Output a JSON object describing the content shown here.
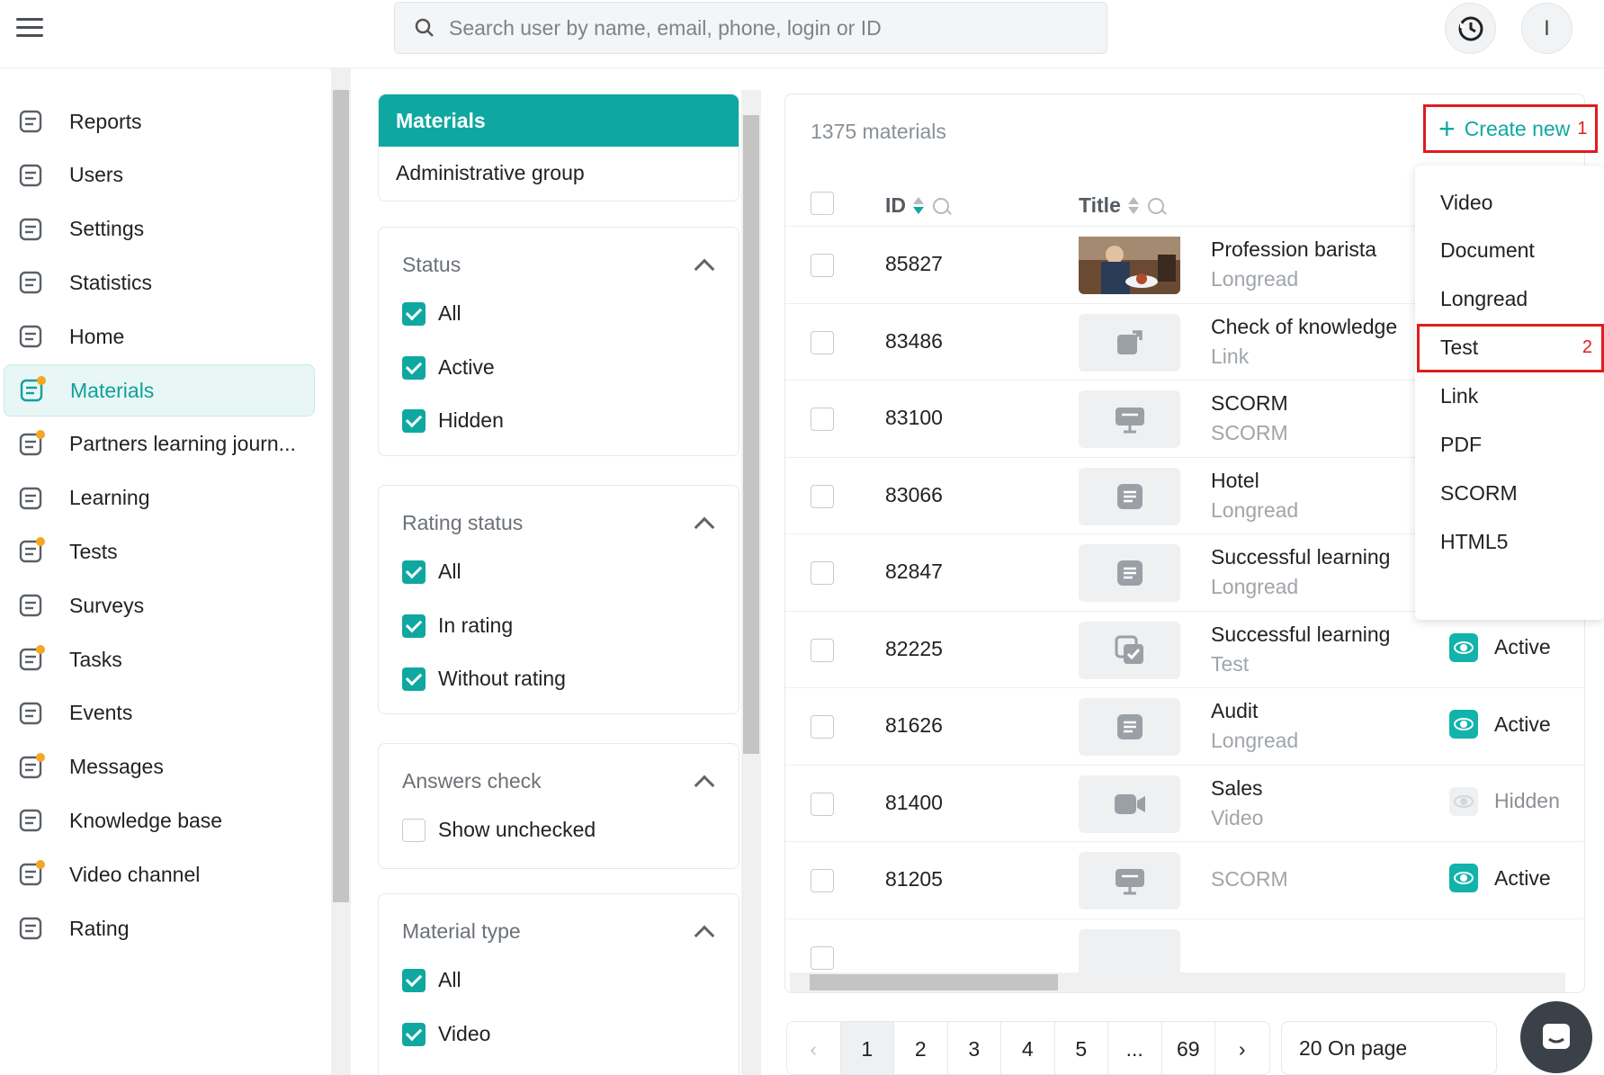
{
  "header": {
    "search_placeholder": "Search user by name, email, phone, login or ID",
    "avatar_initial": "I"
  },
  "sidebar": {
    "items": [
      {
        "label": "Reports",
        "icon": "reports-icon"
      },
      {
        "label": "Users",
        "icon": "users-icon"
      },
      {
        "label": "Settings",
        "icon": "gear-icon"
      },
      {
        "label": "Statistics",
        "icon": "chart-line-icon"
      },
      {
        "label": "Home",
        "icon": "home-icon"
      },
      {
        "label": "Materials",
        "icon": "materials-icon",
        "active": true
      },
      {
        "label": "Partners learning journ...",
        "icon": "partners-icon"
      },
      {
        "label": "Learning",
        "icon": "learning-icon"
      },
      {
        "label": "Tests",
        "icon": "tests-icon"
      },
      {
        "label": "Surveys",
        "icon": "surveys-icon"
      },
      {
        "label": "Tasks",
        "icon": "tasks-icon"
      },
      {
        "label": "Events",
        "icon": "calendar-icon"
      },
      {
        "label": "Messages",
        "icon": "messages-icon"
      },
      {
        "label": "Knowledge base",
        "icon": "info-icon"
      },
      {
        "label": "Video channel",
        "icon": "video-channel-icon"
      },
      {
        "label": "Rating",
        "icon": "trophy-icon"
      }
    ]
  },
  "filters": {
    "tab_active": "Materials",
    "tab_other": "Administrative group",
    "status": {
      "title": "Status",
      "options": [
        "All",
        "Active",
        "Hidden"
      ]
    },
    "rating": {
      "title": "Rating status",
      "options": [
        "All",
        "In rating",
        "Without rating"
      ]
    },
    "answers": {
      "title": "Answers check",
      "options": [
        "Show unchecked"
      ]
    },
    "type": {
      "title": "Material type",
      "options": [
        "All",
        "Video"
      ]
    }
  },
  "table": {
    "count": "1375 materials",
    "create_label": "Create new",
    "create_marker": "1",
    "col_id": "ID",
    "col_title": "Title",
    "rows": [
      {
        "id": "85827",
        "title": "Profession barista",
        "type": "Longread",
        "thumb": "photo"
      },
      {
        "id": "83486",
        "title": "Check of knowledge",
        "type": "Link",
        "thumb": "link-icon"
      },
      {
        "id": "83100",
        "title": "SCORM",
        "type": "SCORM",
        "thumb": "scorm-icon"
      },
      {
        "id": "83066",
        "title": "Hotel",
        "type": "Longread",
        "thumb": "longread-icon"
      },
      {
        "id": "82847",
        "title": "Successful learning",
        "type": "Longread",
        "thumb": "longread-icon"
      },
      {
        "id": "82225",
        "title": "Successful learning",
        "type": "Test",
        "thumb": "test-icon",
        "status": "Active"
      },
      {
        "id": "81626",
        "title": "Audit",
        "type": "Longread",
        "thumb": "longread-icon",
        "status": "Active"
      },
      {
        "id": "81400",
        "title": "Sales",
        "type": "Video",
        "thumb": "video-icon",
        "status": "Hidden"
      },
      {
        "id": "81205",
        "title": "",
        "type": "SCORM",
        "thumb": "scorm-icon",
        "status": "Active"
      }
    ]
  },
  "dropdown": {
    "items": [
      "Video",
      "Document",
      "Longread",
      "Test",
      "Link",
      "PDF",
      "SCORM",
      "HTML5"
    ],
    "highlight_marker": "2"
  },
  "pagination": {
    "pages": [
      "1",
      "2",
      "3",
      "4",
      "5",
      "...",
      "69"
    ],
    "per_page": "20 On page"
  },
  "colors": {
    "accent": "#0fa8a0",
    "highlight_box": "#e01c1c"
  }
}
